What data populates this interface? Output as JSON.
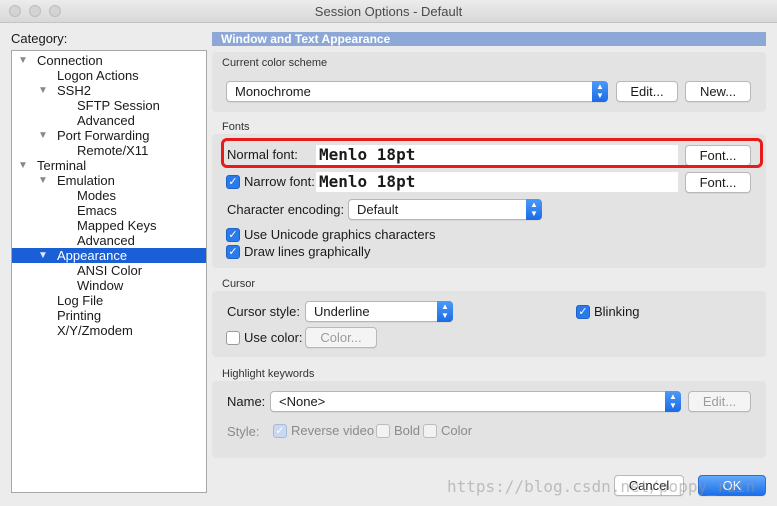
{
  "window": {
    "title": "Session Options - Default"
  },
  "sidebar": {
    "label": "Category:",
    "items": [
      {
        "label": "Connection",
        "level": 0,
        "expanded": true,
        "selected": false
      },
      {
        "label": "Logon Actions",
        "level": 1,
        "expanded": null,
        "selected": false
      },
      {
        "label": "SSH2",
        "level": 1,
        "expanded": true,
        "selected": false
      },
      {
        "label": "SFTP Session",
        "level": 2,
        "expanded": null,
        "selected": false
      },
      {
        "label": "Advanced",
        "level": 2,
        "expanded": null,
        "selected": false
      },
      {
        "label": "Port Forwarding",
        "level": 1,
        "expanded": true,
        "selected": false
      },
      {
        "label": "Remote/X11",
        "level": 2,
        "expanded": null,
        "selected": false
      },
      {
        "label": "Terminal",
        "level": 0,
        "expanded": true,
        "selected": false
      },
      {
        "label": "Emulation",
        "level": 1,
        "expanded": true,
        "selected": false
      },
      {
        "label": "Modes",
        "level": 2,
        "expanded": null,
        "selected": false
      },
      {
        "label": "Emacs",
        "level": 2,
        "expanded": null,
        "selected": false
      },
      {
        "label": "Mapped Keys",
        "level": 2,
        "expanded": null,
        "selected": false
      },
      {
        "label": "Advanced",
        "level": 2,
        "expanded": null,
        "selected": false
      },
      {
        "label": "Appearance",
        "level": 1,
        "expanded": true,
        "selected": true
      },
      {
        "label": "ANSI Color",
        "level": 2,
        "expanded": null,
        "selected": false
      },
      {
        "label": "Window",
        "level": 2,
        "expanded": null,
        "selected": false
      },
      {
        "label": "Log File",
        "level": 1,
        "expanded": null,
        "selected": false
      },
      {
        "label": "Printing",
        "level": 1,
        "expanded": null,
        "selected": false
      },
      {
        "label": "X/Y/Zmodem",
        "level": 1,
        "expanded": null,
        "selected": false
      }
    ]
  },
  "main": {
    "section_title": "Window and Text Appearance",
    "color_scheme": {
      "group_label": "Current color scheme",
      "selected": "Monochrome",
      "edit_label": "Edit...",
      "new_label": "New..."
    },
    "fonts": {
      "group_label": "Fonts",
      "normal_font_label": "Normal font:",
      "normal_font_value": "Menlo 18pt",
      "normal_font_button": "Font...",
      "narrow_font_checked": true,
      "narrow_font_label": "Narrow font:",
      "narrow_font_value": "Menlo 18pt",
      "narrow_font_button": "Font...",
      "encoding_label": "Character encoding:",
      "encoding_value": "Default",
      "unicode_checked": true,
      "unicode_label": "Use Unicode graphics characters",
      "draw_lines_checked": true,
      "draw_lines_label": "Draw lines graphically"
    },
    "cursor": {
      "group_label": "Cursor",
      "style_label": "Cursor style:",
      "style_value": "Underline",
      "blinking_checked": true,
      "blinking_label": "Blinking",
      "use_color_checked": false,
      "use_color_label": "Use color:",
      "color_button": "Color..."
    },
    "highlight": {
      "group_label": "Highlight keywords",
      "name_label": "Name:",
      "name_value": "<None>",
      "edit_label": "Edit...",
      "style_label": "Style:",
      "reverse_video_checked": true,
      "reverse_video_label": "Reverse video",
      "bold_checked": false,
      "bold_label": "Bold",
      "color_checked": false,
      "color_label": "Color"
    }
  },
  "footer": {
    "cancel_label": "Cancel",
    "ok_label": "OK"
  },
  "watermark": "https://blog.csdn.net/poppy_rain",
  "colors": {
    "selection": "#1a5fd6",
    "annotation_box": "#e81a1a",
    "banner": "#8da8d6"
  }
}
